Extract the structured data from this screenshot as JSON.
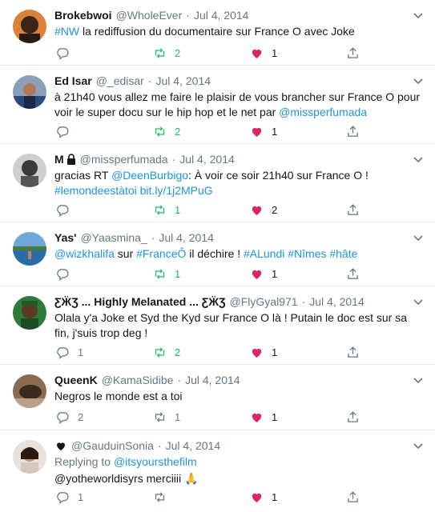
{
  "colors": {
    "link": "#1b95e0",
    "retweet": "#17bf63",
    "like": "#e0245e",
    "muted": "#657786"
  },
  "tweets": [
    {
      "name": "Brokebwoi",
      "handle": "@WholeEver",
      "sep": "·",
      "date": "Jul 4, 2014",
      "text": [
        {
          "link": "#NW"
        },
        {
          "t": " la rediffusion du documentaire sur France O avec Joke"
        }
      ],
      "reply_count": "",
      "retweet_count": "2",
      "like_count": "1"
    },
    {
      "name": "Ed Isar",
      "handle": "@_edisar",
      "sep": "·",
      "date": "Jul 4, 2014",
      "text": [
        {
          "t": "à 21h40 vous allez me faire le plaisir de vous brancher sur France O pour voir le super docu sur le hip hop et le net par "
        },
        {
          "link": "@missperfumada"
        }
      ],
      "reply_count": "",
      "retweet_count": "2",
      "like_count": "1"
    },
    {
      "name": "M",
      "handle": "@missperfumada",
      "sep": "·",
      "date": "Jul 4, 2014",
      "locked": true,
      "text": [
        {
          "t": "gracias RT "
        },
        {
          "link": "@DeenBurbigo"
        },
        {
          "t": ": À voir ce soir 21h40 sur France O ! "
        },
        {
          "link": "#lemondeestàtoi"
        },
        {
          "t": " "
        },
        {
          "link": "bit.ly/1j2MPuG"
        }
      ],
      "reply_count": "",
      "retweet_count": "1",
      "like_count": "2"
    },
    {
      "name": "Yas'",
      "handle": "@Yaasmina_",
      "sep": "·",
      "date": "Jul 4, 2014",
      "text": [
        {
          "link": "@wizkhalifa"
        },
        {
          "t": " sur "
        },
        {
          "link": "#FranceÔ"
        },
        {
          "t": " il déchire ! "
        },
        {
          "link": "#ALundi"
        },
        {
          "t": " "
        },
        {
          "link": "#Nîmes"
        },
        {
          "t": " "
        },
        {
          "link": "#hâte"
        }
      ],
      "reply_count": "",
      "retweet_count": "1",
      "like_count": "1"
    },
    {
      "name": "ƸӜƷ ... Highly Melanated ... ƸӜƷ",
      "handle": "@FlyGyal971",
      "sep": "·",
      "date": "Jul 4, 2014",
      "text": [
        {
          "t": "Olala y'a Joke et Syd the Kyd sur France O là ! Putain le doc est sur sa fin, j'suis trop deg !"
        }
      ],
      "reply_count": "1",
      "retweet_count": "2",
      "like_count": "1"
    },
    {
      "name": "QueenK",
      "handle": "@KamaSidibe",
      "sep": "·",
      "date": "Jul 4, 2014",
      "text": [
        {
          "t": "Negros le monde est a toi"
        }
      ],
      "reply_count": "2",
      "retweet_count": "1",
      "like_count": "1"
    },
    {
      "name": "",
      "name_icon": "heart-icon",
      "handle": "@GauduinSonia",
      "sep": "·",
      "date": "Jul 4, 2014",
      "replying_prefix": "Replying to ",
      "replying_to": "@itsyoursthefilm",
      "text": [
        {
          "link": "@yotheworldisyrs"
        },
        {
          "t": " merciiii 🙏"
        }
      ],
      "reply_count": "1",
      "retweet_count": "",
      "like_count": "1"
    }
  ]
}
